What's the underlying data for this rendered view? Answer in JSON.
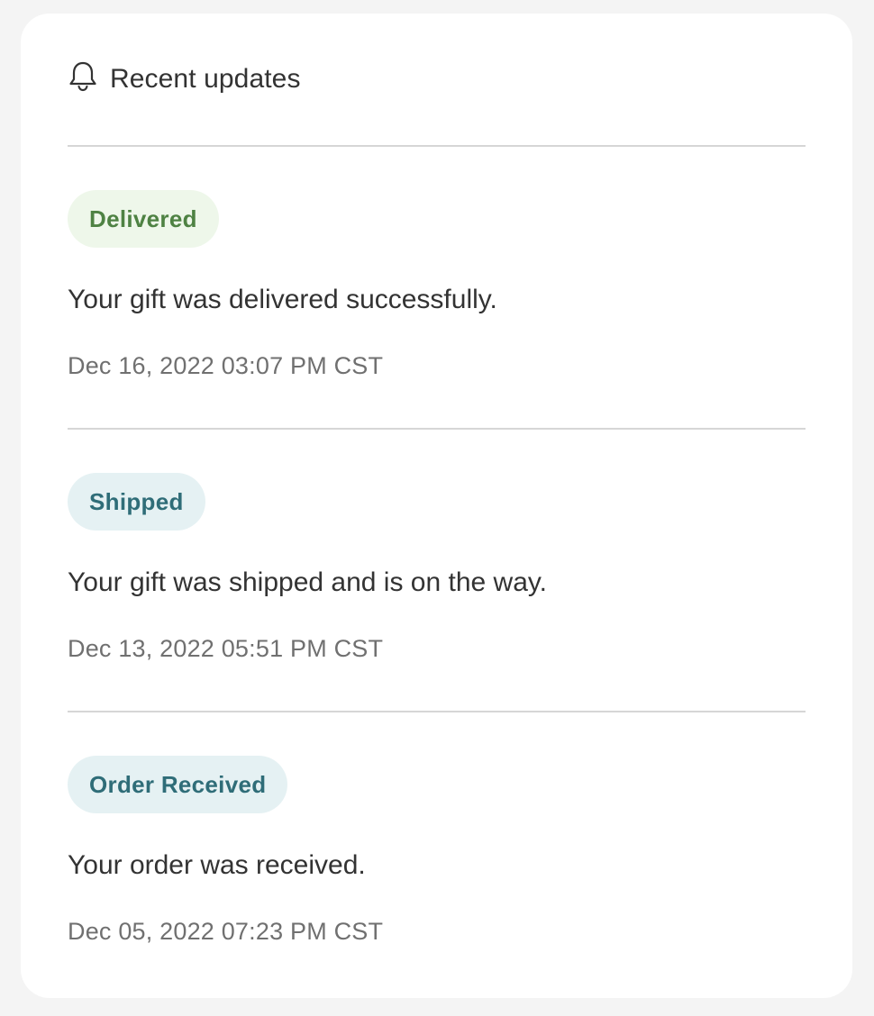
{
  "header": {
    "icon": "bell-icon",
    "title": "Recent updates"
  },
  "updates": [
    {
      "status": "Delivered",
      "status_color": "#4e8243",
      "status_bg": "#eef7ea",
      "message": "Your gift was delivered successfully.",
      "timestamp": "Dec 16, 2022 03:07 PM CST"
    },
    {
      "status": "Shipped",
      "status_color": "#2f6d78",
      "status_bg": "#e5f1f3",
      "message": "Your gift was shipped and is on the way.",
      "timestamp": "Dec 13, 2022 05:51 PM CST"
    },
    {
      "status": "Order Received",
      "status_color": "#2f6d78",
      "status_bg": "#e5f1f3",
      "message": "Your order was received.",
      "timestamp": "Dec 05, 2022 07:23 PM CST"
    }
  ]
}
